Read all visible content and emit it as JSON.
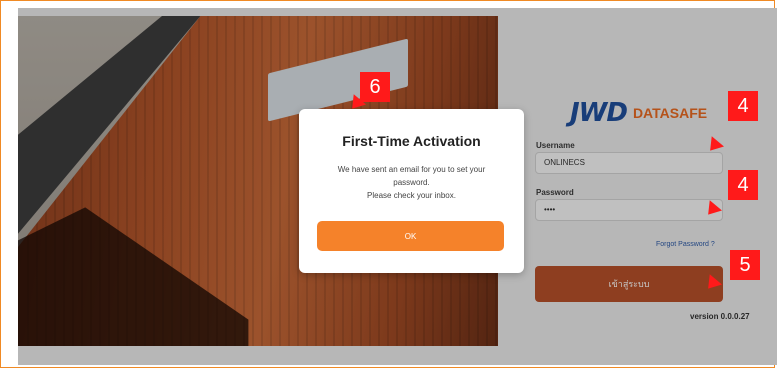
{
  "brand": {
    "mark": "JWD",
    "name": "DATASAFE"
  },
  "login": {
    "username_label": "Username",
    "username_value": "ONLINECS",
    "password_label": "Password",
    "password_value": "••••",
    "forgot_label": "Forgot Password ?",
    "login_button": "เข้าสู่ระบบ",
    "version": "version 0.0.0.27"
  },
  "modal": {
    "title": "First-Time Activation",
    "line1": "We have sent an email for you to set your",
    "line2": "password.",
    "line3": "Please check your inbox.",
    "ok_label": "OK"
  },
  "annotations": [
    "6",
    "4",
    "4",
    "5"
  ],
  "colors": {
    "accent": "#f5822a",
    "login_button": "#b6502a",
    "brand_blue": "#1f4f9c",
    "marker": "#ff1a1a"
  }
}
